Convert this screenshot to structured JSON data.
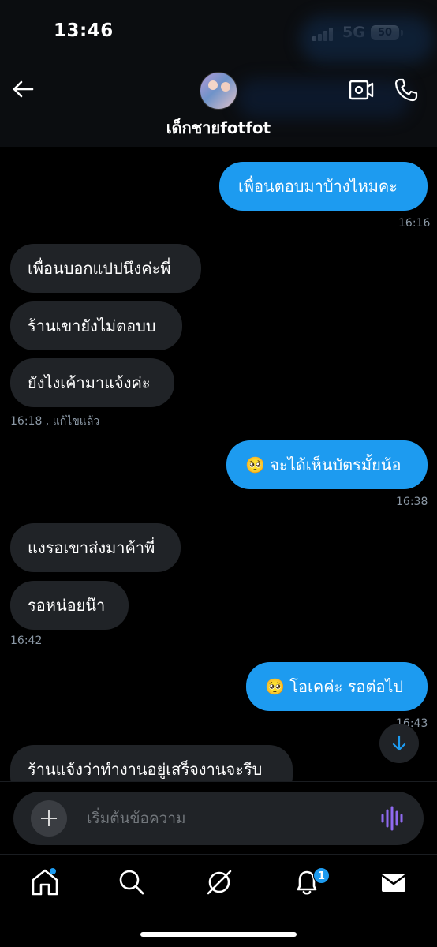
{
  "status_bar": {
    "time": "13:46",
    "network": "5G",
    "battery": "50"
  },
  "header": {
    "contact_name": "เด็กชายfotfot"
  },
  "messages": [
    {
      "text": "เพื่อนตอบมาบ้างไหมคะ",
      "time": "16:16"
    },
    {
      "text": "เพื่อนบอกแปปนึงค่ะพี่"
    },
    {
      "text": "ร้านเขายังไม่ตอบบ"
    },
    {
      "text": "ยังไงเค้ามาแจ้งค่ะ",
      "time": "16:18 , แก้ไขแล้ว"
    },
    {
      "emoji": "🥺",
      "text": "จะได้เห็นบัตรมั้ยน้อ",
      "time": "16:38"
    },
    {
      "text": "แงรอเขาส่งมาค้าพี่"
    },
    {
      "text": "รอหน่อยน๊า",
      "time": "16:42"
    },
    {
      "emoji": "🥺",
      "text": "โอเคค่ะ รอต่อไป",
      "time": "16:43"
    },
    {
      "text": "ร้านแจ้งว่าทำงานอยู่เสร็จงานจะรีบ"
    }
  ],
  "composer": {
    "placeholder": "เริ่มต้นข้อความ"
  },
  "bottom_nav": {
    "items": [
      "home-icon",
      "search-icon",
      "grok-icon",
      "notifications-icon",
      "messages-icon"
    ],
    "notification_count": "1"
  },
  "colors": {
    "accent": "#1d9bf0",
    "incoming_bubble": "#202327",
    "voice_icon": "#8f6af0"
  }
}
